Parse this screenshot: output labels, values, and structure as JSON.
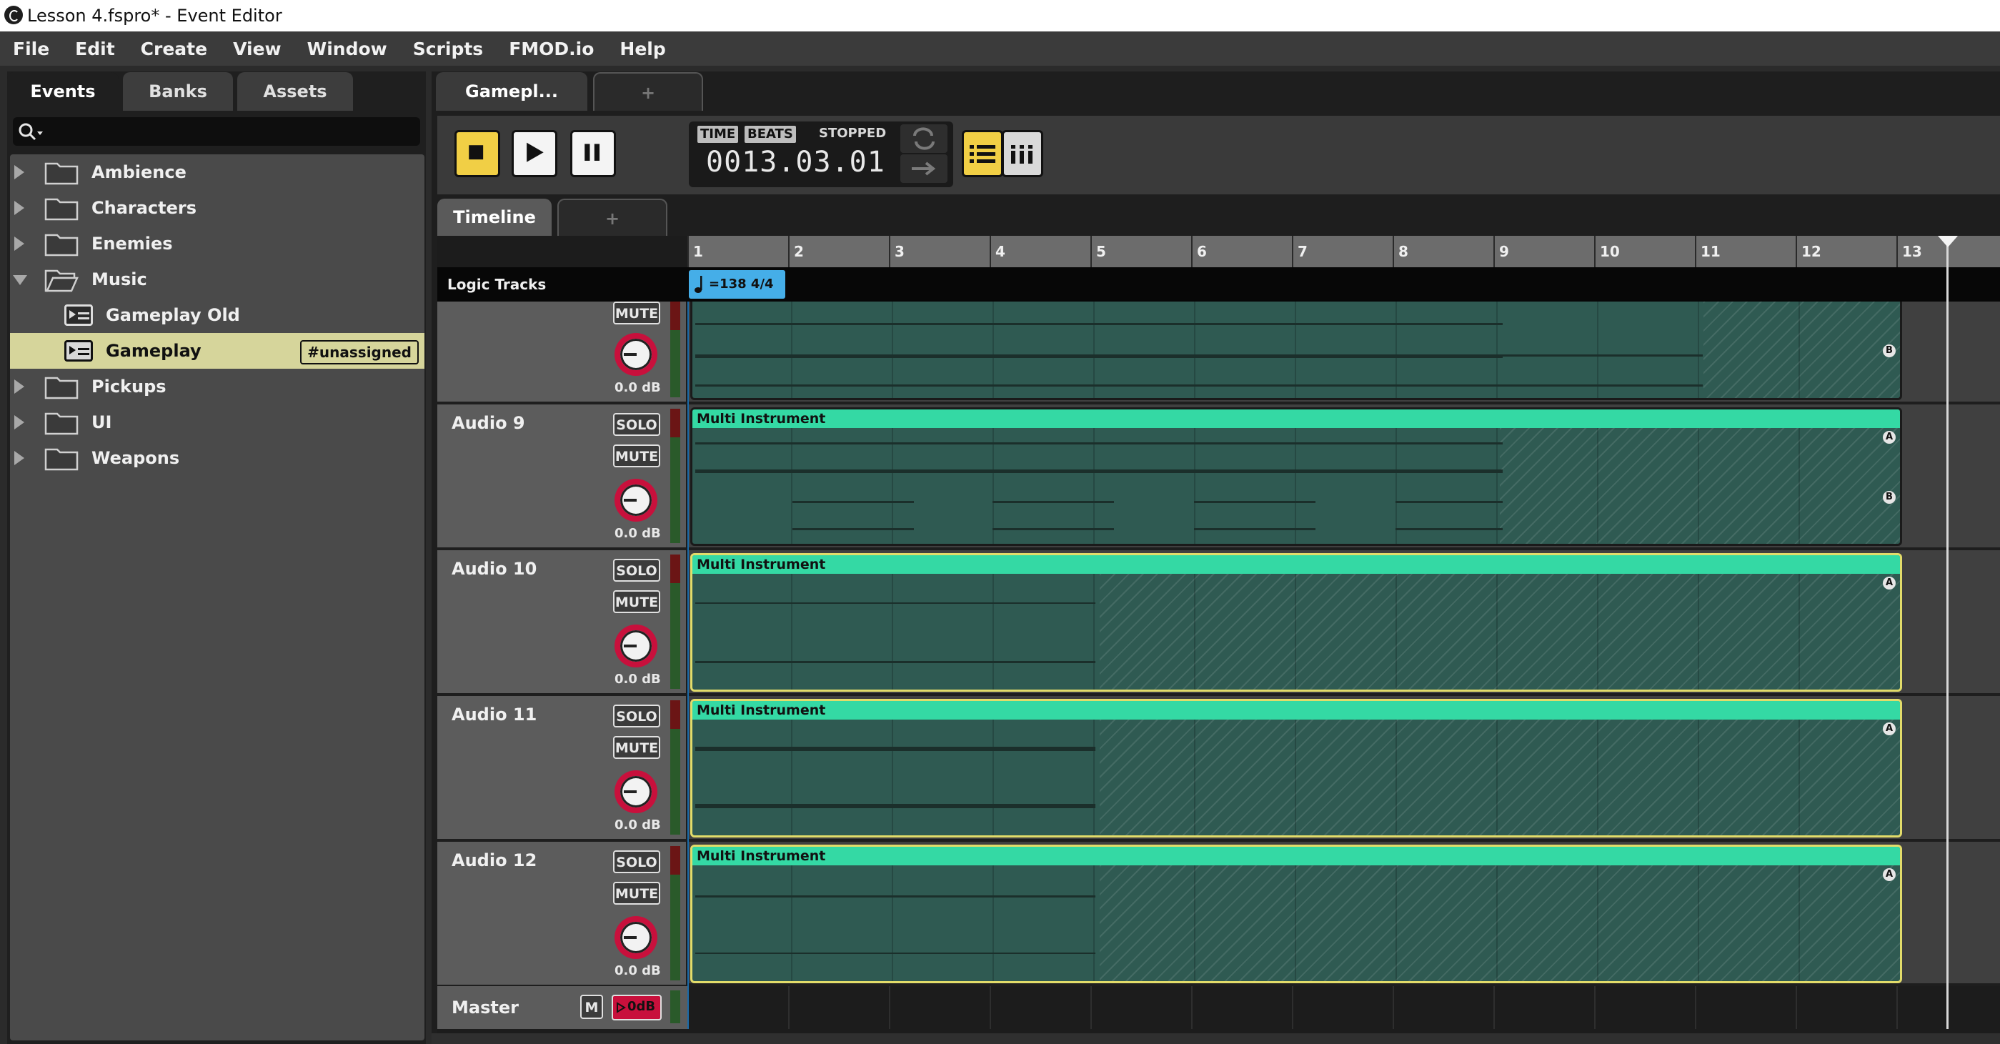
{
  "window": {
    "title": "Lesson 4.fspro* - Event Editor"
  },
  "menu": [
    "File",
    "Edit",
    "Create",
    "View",
    "Window",
    "Scripts",
    "FMOD.io",
    "Help"
  ],
  "browser": {
    "tabs": [
      "Events",
      "Banks",
      "Assets"
    ],
    "active_tab": "Events",
    "search_placeholder": "",
    "tree": [
      {
        "label": "Ambience",
        "type": "folder",
        "expanded": false
      },
      {
        "label": "Characters",
        "type": "folder",
        "expanded": false
      },
      {
        "label": "Enemies",
        "type": "folder",
        "expanded": false
      },
      {
        "label": "Music",
        "type": "folder",
        "expanded": true
      },
      {
        "label": "Gameplay Old",
        "type": "event"
      },
      {
        "label": "Gameplay",
        "type": "event",
        "selected": true,
        "badge": "#unassigned"
      },
      {
        "label": "Pickups",
        "type": "folder",
        "expanded": false
      },
      {
        "label": "UI",
        "type": "folder",
        "expanded": false
      },
      {
        "label": "Weapons",
        "type": "folder",
        "expanded": false
      }
    ]
  },
  "editor": {
    "tabs": [
      "Gamepl...",
      "+"
    ],
    "transport": {
      "time_label": "TIME",
      "beats_label": "BEATS",
      "state": "STOPPED",
      "position": "0013.03.01"
    },
    "subtabs": [
      "Timeline",
      "+"
    ],
    "ruler": [
      "1",
      "2",
      "3",
      "4",
      "5",
      "6",
      "7",
      "8",
      "9",
      "10",
      "11",
      "12",
      "13"
    ],
    "logic_tracks_label": "Logic Tracks",
    "tempo_marker": "=138 4/4",
    "tracks": [
      {
        "name": "",
        "solo": "",
        "mute": "MUTE",
        "db": "0.0 dB",
        "region": "",
        "markers": [
          "B"
        ]
      },
      {
        "name": "Audio 9",
        "solo": "SOLO",
        "mute": "MUTE",
        "db": "0.0 dB",
        "region": "Multi Instrument",
        "markers": [
          "A",
          "B"
        ]
      },
      {
        "name": "Audio 10",
        "solo": "SOLO",
        "mute": "MUTE",
        "db": "0.0 dB",
        "region": "Multi Instrument",
        "markers": [
          "A"
        ]
      },
      {
        "name": "Audio 11",
        "solo": "SOLO",
        "mute": "MUTE",
        "db": "0.0 dB",
        "region": "Multi Instrument",
        "markers": [
          "A"
        ]
      },
      {
        "name": "Audio 12",
        "solo": "SOLO",
        "mute": "MUTE",
        "db": "0.0 dB",
        "region": "Multi Instrument",
        "markers": [
          "A"
        ]
      }
    ],
    "master": {
      "name": "Master",
      "m_label": "M",
      "level": "0dB"
    }
  },
  "colors": {
    "accent_yellow": "#f1cf45",
    "region_header": "#34d9a4",
    "region_body": "#2f5a52",
    "selection": "#d6d59b",
    "tempo_marker": "#45aee8",
    "knob_red": "#c8103c"
  }
}
